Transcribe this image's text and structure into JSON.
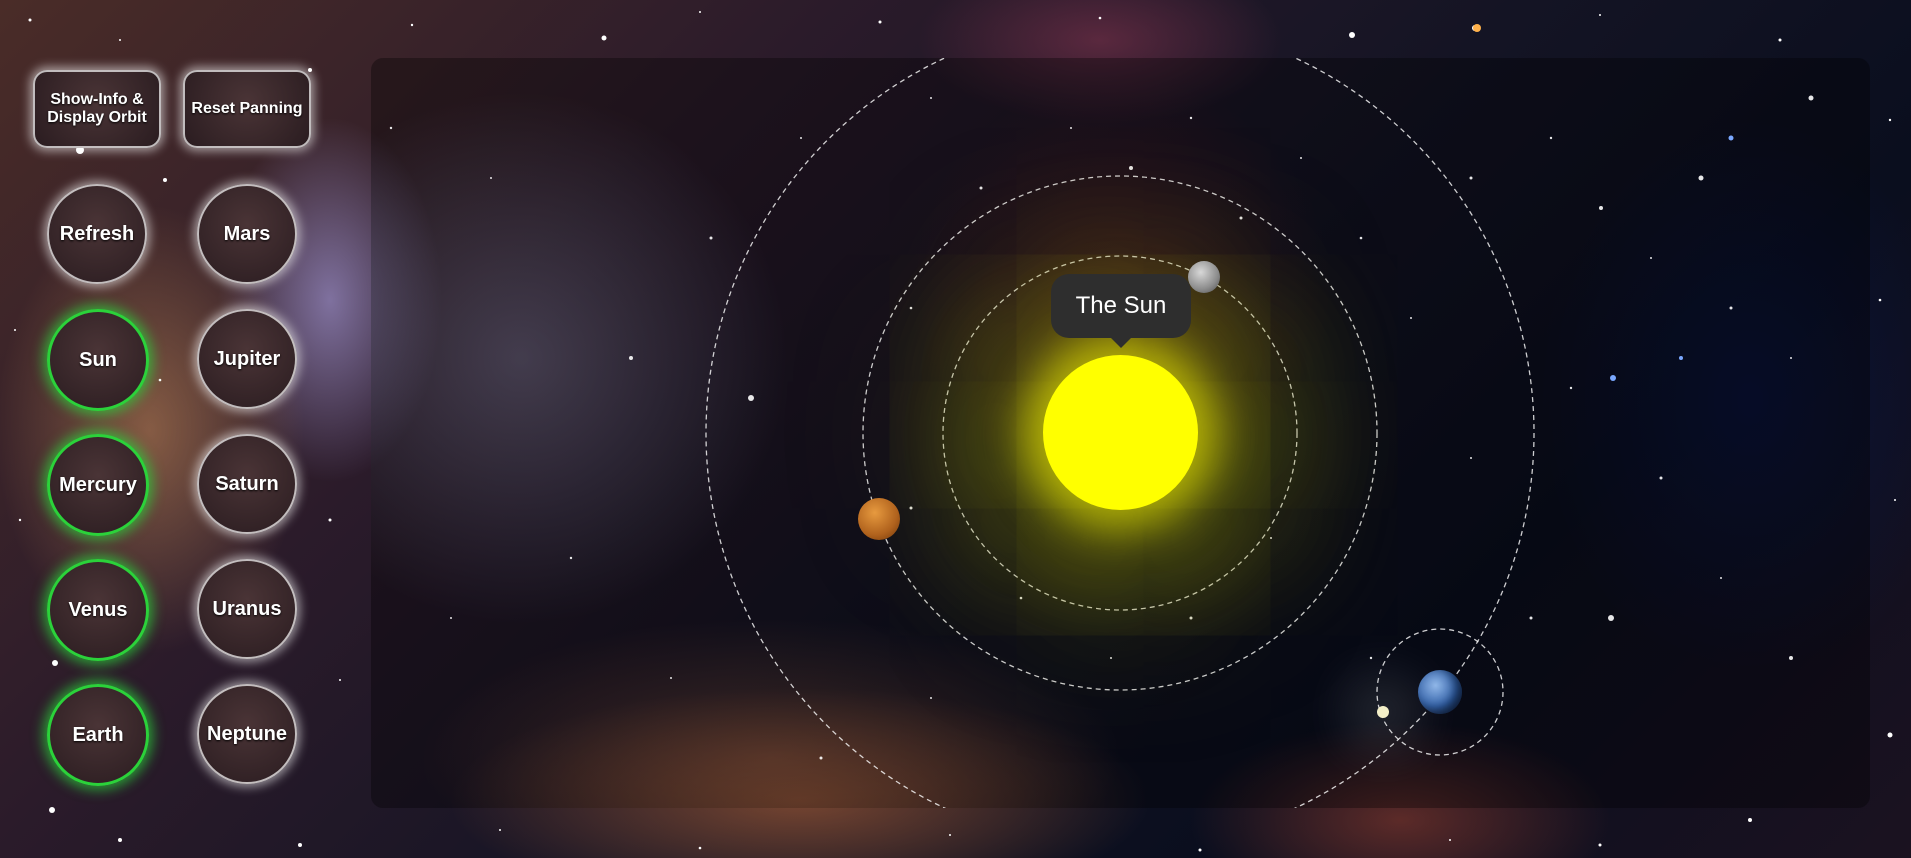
{
  "controls": {
    "show_info_label": "Show-Info & Display Orbit",
    "reset_label": "Reset Panning",
    "refresh_label": "Refresh"
  },
  "planet_buttons": {
    "sun": "Sun",
    "mercury": "Mercury",
    "venus": "Venus",
    "earth": "Earth",
    "mars": "Mars",
    "jupiter": "Jupiter",
    "saturn": "Saturn",
    "uranus": "Uranus",
    "neptune": "Neptune"
  },
  "active_buttons": [
    "Sun",
    "Mercury",
    "Venus",
    "Earth"
  ],
  "viewport": {
    "tooltip": "The Sun"
  },
  "colors": {
    "sun": "#ffff00",
    "active_ring": "#2bd23a",
    "tooltip_bg": "#2e2e2e"
  }
}
